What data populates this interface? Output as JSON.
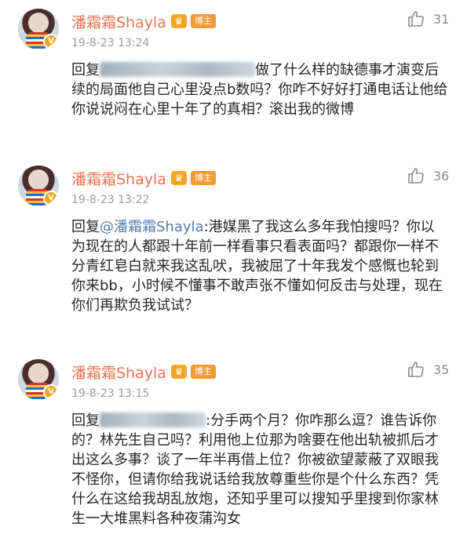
{
  "comments": [
    {
      "username": "潘霜霜Shayla",
      "badge": "博主",
      "time": "19-8-23 13:24",
      "likes": "31",
      "reply_prefix": "回复",
      "mention": "",
      "body": "做了什么样的缺德事才演变后续的局面他自己心里没点b数吗？你咋不好好打通电话让他给你说说闷在心里十年了的真相？滚出我的微博"
    },
    {
      "username": "潘霜霜Shayla",
      "badge": "博主",
      "time": "19-8-23 13:22",
      "likes": "36",
      "reply_prefix": "回复",
      "mention": "@潘霜霜Shayla",
      "body": ":港媒黑了我这么多年我怕搜吗？你以为现在的人都跟十年前一样看事只看表面吗？都跟你一样不分青红皂白就来我这乱吠，我被屈了十年我发个感慨也轮到你来bb，小时候不懂事不敢声张不懂如何反击与处理，现在你们再欺负我试试？"
    },
    {
      "username": "潘霜霜Shayla",
      "badge": "博主",
      "time": "19-8-23 13:15",
      "likes": "35",
      "reply_prefix": "回复",
      "mention": "",
      "body": ":分手两个月？你咋那么逗？谁告诉你的？林先生自己吗？利用他上位那为啥要在他出轨被抓后才出这么多事？谈了一年半再借上位？你被欲望蒙蔽了双眼我不怪你，但请你给我说话给我放尊重些你是个什么东西？凭什么在这给我胡乱放炮，还知乎里可以搜知乎里搜到你家林生一大堆黑料各种夜蒲沟女"
    }
  ],
  "icons": {
    "like": "thumbs-up-outline-icon",
    "verified": "verified-v-icon",
    "crown": "crown-icon"
  },
  "colors": {
    "username": "#eb7350",
    "badge": "#f29a36",
    "mention": "#507daf",
    "meta": "#9b9b9b"
  }
}
